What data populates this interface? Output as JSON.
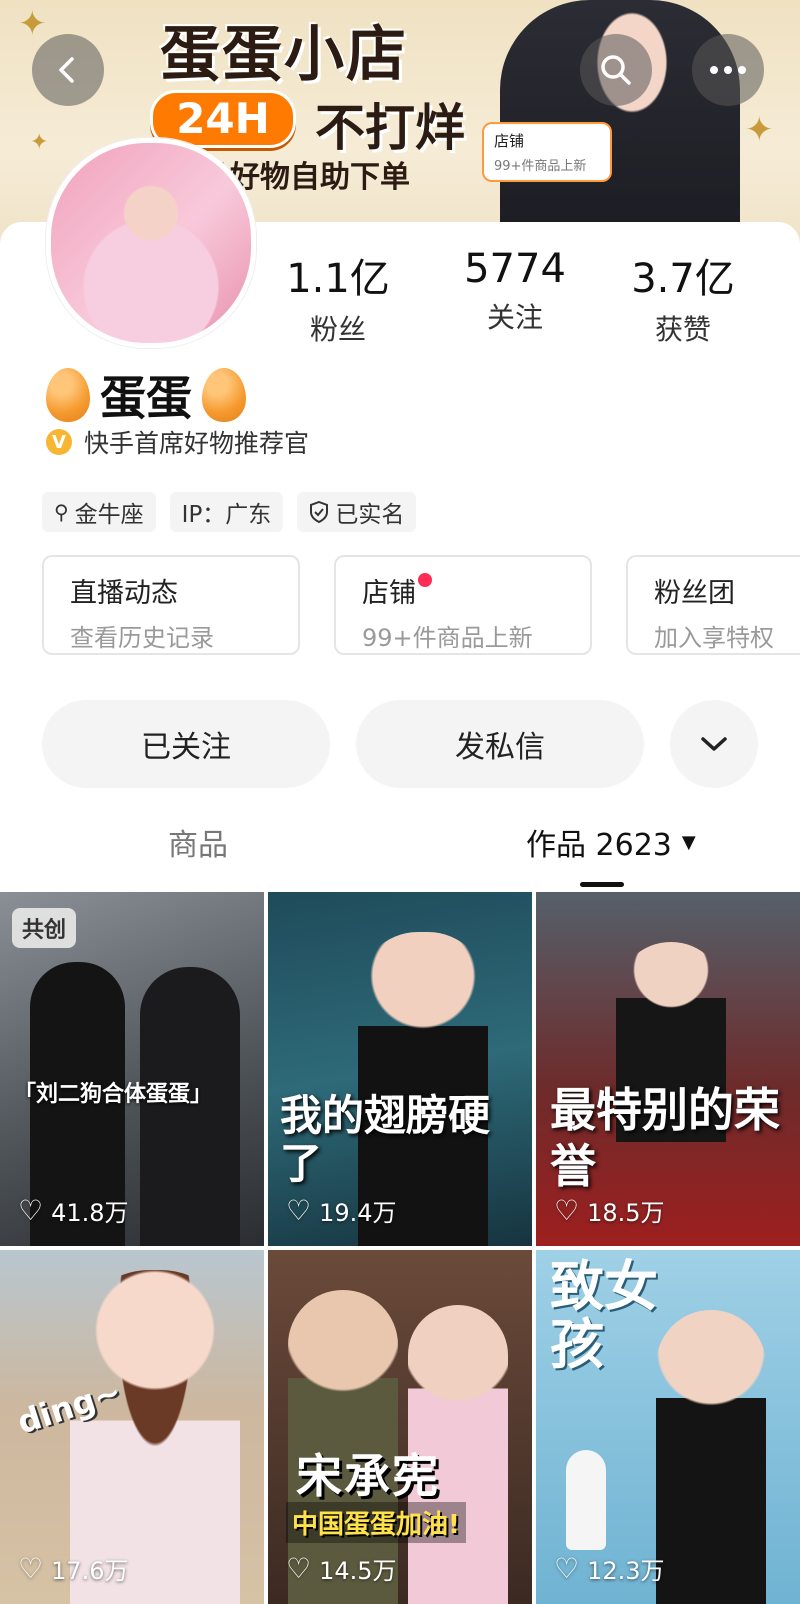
{
  "banner": {
    "title": "蛋蛋小店",
    "badge": "24H",
    "badge_text": "不打烊",
    "subtitle": "品好物自助下单",
    "shop_tag": {
      "title": "店铺",
      "subtitle": "99+件商品上新"
    }
  },
  "nav": {
    "back_icon": "back-chevron-icon",
    "search_icon": "search-icon",
    "more_icon": "more-dots-icon"
  },
  "profile": {
    "stats": [
      {
        "value": "1.1亿",
        "label": "粉丝"
      },
      {
        "value": "5774",
        "label": "关注"
      },
      {
        "value": "3.7亿",
        "label": "获赞"
      }
    ],
    "name": "蛋蛋",
    "verification": "快手首席好物推荐官",
    "tags": [
      {
        "icon": "zodiac-icon",
        "text": "金牛座"
      },
      {
        "icon": "",
        "text": "IP：广东"
      },
      {
        "icon": "shield-check-icon",
        "text": "已实名"
      }
    ]
  },
  "features": [
    {
      "title": "直播动态",
      "subtitle": "查看历史记录"
    },
    {
      "title": "店铺",
      "subtitle": "99+件商品上新",
      "dot": true
    },
    {
      "title": "粉丝团",
      "subtitle": "加入享特权"
    }
  ],
  "actions": {
    "followed": "已关注",
    "message": "发私信",
    "dropdown_icon": "chevron-down-icon"
  },
  "tabs": [
    {
      "label": "商品",
      "active": false
    },
    {
      "label": "作品 2623",
      "active": true
    }
  ],
  "videos": [
    {
      "likes": "41.8万",
      "chip": "共创",
      "caption": "「刘二狗合体蛋蛋」"
    },
    {
      "likes": "19.4万",
      "caption": "我的翅膀硬了"
    },
    {
      "likes": "18.5万",
      "caption": "最特别的荣誉"
    },
    {
      "likes": "17.6万",
      "caption": "ding~"
    },
    {
      "likes": "14.5万",
      "caption": "宋承宪",
      "caption2": "中国蛋蛋加油!"
    },
    {
      "likes": "12.3万",
      "caption": "致女孩"
    }
  ],
  "colors": {
    "accent_orange": "#ff7a00",
    "notification_red": "#ff2c55",
    "verify_gold": "#f6b632"
  }
}
